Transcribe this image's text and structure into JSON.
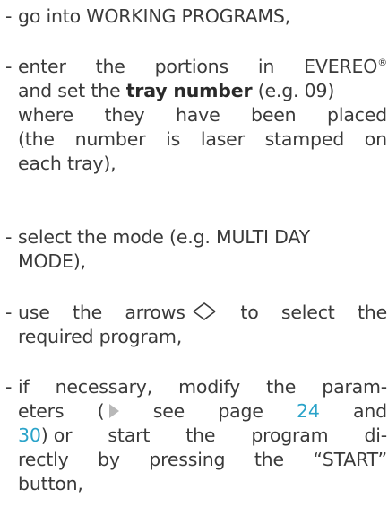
{
  "instructions": {
    "dash": "-",
    "item1": {
      "text": "go into WORKING PROGRAMS,"
    },
    "item2": {
      "line1": [
        "enter",
        "the",
        "portions",
        "in",
        "EVEREO"
      ],
      "reg": "®",
      "line2_pre": "and set the",
      "line2_bold": "tray number",
      "line2_post": "(e.g. 09)",
      "line3": [
        "where",
        "they",
        "have",
        "been",
        "placed"
      ],
      "line4": [
        "(the",
        "number",
        "is",
        "laser",
        "stamped",
        "on"
      ],
      "line5": "each tray),"
    },
    "item3": {
      "line1": [
        "select the mode (e.g. MULTI DAY"
      ],
      "line2": "MODE),"
    },
    "item4": {
      "line1_pre": "use",
      "line1_mid": "the",
      "line1_arrows": "arrows",
      "line1_post": [
        "to",
        "select",
        "the"
      ],
      "line2": "required program,",
      "arrows_icon": "up-down-diamond-icon"
    },
    "item5": {
      "line1": [
        "if",
        "necessary,",
        "modify",
        "the",
        "param-"
      ],
      "line2_pre": "eters",
      "line2_paren": "(",
      "line2_see": "see",
      "line2_page": "page",
      "line2_link1": "24",
      "line2_and": "and",
      "line3_link2": "30",
      "line3_rest": [
        ") or",
        "start",
        "the",
        "program",
        "di-"
      ],
      "line4": [
        "rectly",
        "by",
        "pressing",
        "the",
        "“START”"
      ],
      "line5": "button,",
      "pointer_icon": "right-triangle-icon",
      "link_color": "#2aa3c9"
    }
  }
}
